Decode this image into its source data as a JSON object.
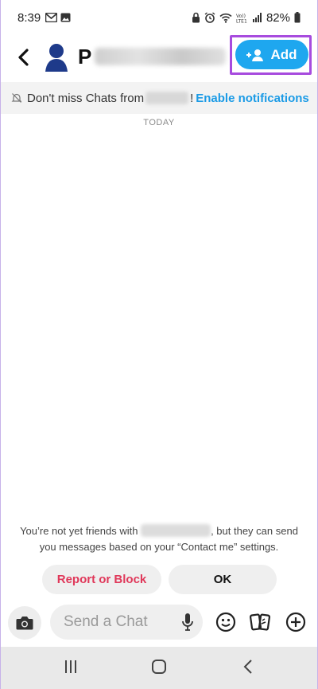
{
  "status": {
    "time": "8:39",
    "battery": "82%"
  },
  "header": {
    "contact_initial": "P",
    "add_label": "Add"
  },
  "notice": {
    "prefix": "Don't miss Chats from",
    "suffix": "!",
    "link": "Enable notifications"
  },
  "divider": "TODAY",
  "friend_info": {
    "part1": "You’re not yet friends with",
    "part2": ", but they can send",
    "line2": "you messages based on your “Contact me” settings."
  },
  "actions": {
    "report": "Report or Block",
    "ok": "OK"
  },
  "composer": {
    "placeholder": "Send a Chat"
  },
  "colors": {
    "accent": "#1ea7ef",
    "highlight": "#a74bde",
    "danger": "#e0385a",
    "link": "#1b9be6"
  }
}
